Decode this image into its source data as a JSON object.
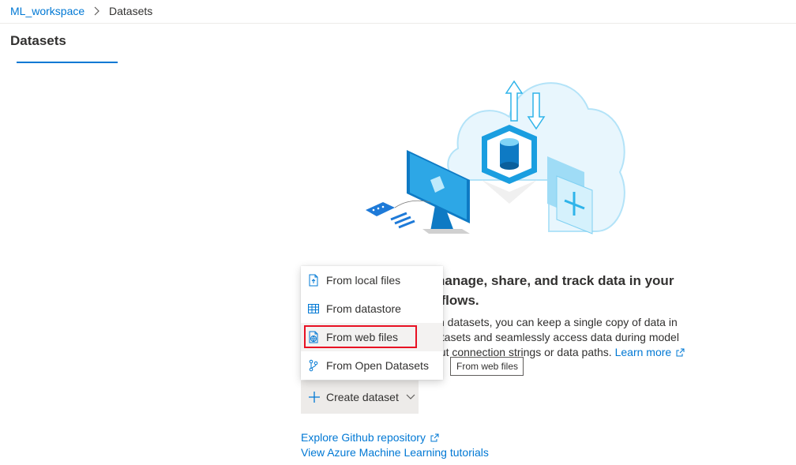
{
  "breadcrumb": {
    "workspace": "ML_workspace",
    "current": "Datasets"
  },
  "page": {
    "title": "Datasets"
  },
  "intro": {
    "headline": "Create datasets to manage, share, and track data in your machine learning workflows.",
    "visible_headline_line1": "nanage, share, and track data in your",
    "visible_headline_line2": "kflows.",
    "description_line1": "n datasets, you can keep a single copy of data in",
    "description_line2": "atasets and seamlessly access data during model",
    "description_line3": "out connection strings or data paths.",
    "learn_more": "Learn more"
  },
  "create_button": {
    "label": "Create dataset"
  },
  "menu": {
    "items": [
      {
        "label": "From local files",
        "icon": "file-upload-icon"
      },
      {
        "label": "From datastore",
        "icon": "table-icon"
      },
      {
        "label": "From web files",
        "icon": "web-file-icon"
      },
      {
        "label": "From Open Datasets",
        "icon": "open-datasets-icon"
      }
    ]
  },
  "tooltip": {
    "text": "From web files"
  },
  "links": {
    "github": "Explore Github repository",
    "tutorials": "View Azure Machine Learning tutorials"
  },
  "colors": {
    "accent": "#0078d4",
    "highlight": "#e81123",
    "button_bg": "#edebe9"
  }
}
